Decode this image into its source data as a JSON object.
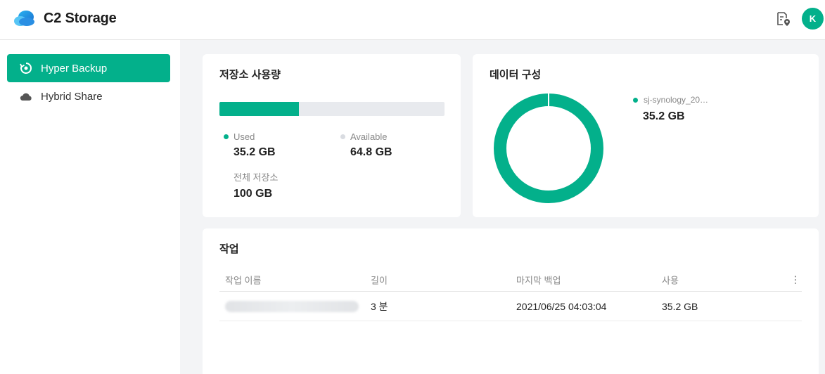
{
  "header": {
    "app_title": "C2 Storage",
    "avatar_initial": "K"
  },
  "sidebar": {
    "items": [
      {
        "label": "Hyper Backup",
        "active": true
      },
      {
        "label": "Hybrid Share",
        "active": false
      }
    ]
  },
  "usage": {
    "title": "저장소 사용량",
    "used_fraction": 0.352,
    "used_label": "Used",
    "used_value": "35.2 GB",
    "available_label": "Available",
    "available_value": "64.8 GB",
    "total_label": "전체 저장소",
    "total_value": "100 GB"
  },
  "composition": {
    "title": "데이터 구성",
    "legend_label": "sj-synology_20…",
    "legend_value": "35.2 GB"
  },
  "jobs": {
    "title": "작업",
    "columns": [
      "작업 이름",
      "길이",
      "마지막 백업",
      "사용"
    ],
    "rows": [
      {
        "duration": "3 분",
        "last_backup": "2021/06/25 04:03:04",
        "usage": "35.2 GB"
      }
    ]
  },
  "colors": {
    "accent": "#03b08b",
    "track": "#e8eaee",
    "available_dot": "#d9dce1"
  },
  "icons": {
    "logo": "cloud-logo-icon",
    "header_action": "location-file-icon",
    "menu": "more-vertical-icon"
  }
}
